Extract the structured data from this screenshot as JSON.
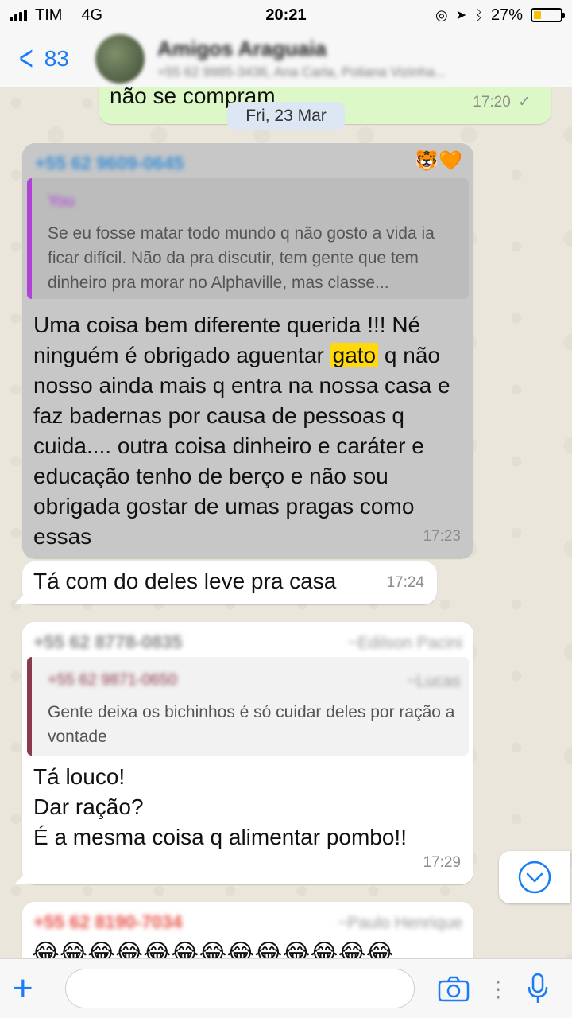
{
  "status_bar": {
    "carrier": "TIM",
    "network": "4G",
    "time": "20:21",
    "battery_percent": "27%",
    "battery_level": 0.27
  },
  "header": {
    "back_count": "83",
    "title": "Amigos Araguaia",
    "subtitle": "+55 62 9985-3436, Ana Carla, Poliana Vizinha..."
  },
  "chat": {
    "date_label": "Fri, 23 Mar",
    "messages": [
      {
        "text": "não se compram",
        "time": "17:20",
        "status_icon": "checkmark-icon"
      },
      {
        "sender": "+55 62 9609-0645",
        "reactions": "🐯🧡",
        "quote_author": "You",
        "quote_text": "Se eu fosse matar todo mundo q não gosto a vida ia ficar difícil. Não da pra discutir, tem gente que tem dinheiro pra morar no Alphaville, mas classe...",
        "text_before": "Uma coisa bem diferente querida !!! Né ninguém é obrigado aguentar ",
        "highlight": "gato",
        "text_after": " q não nosso ainda mais q entra na nossa casa e faz badernas por causa de pessoas q cuida.... outra coisa dinheiro e caráter e educação tenho de berço e não sou obrigada gostar de umas pragas como essas",
        "time": "17:23"
      },
      {
        "text": "Tá com do deles leve pra casa",
        "time": "17:24"
      },
      {
        "sender": "+55 62 8778-0835",
        "sender_name": "~Edilson Pacini",
        "quote_author": "+55 62 9871-0650",
        "quote_author_name": "~Lucas",
        "quote_text": "Gente deixa os bichinhos é só cuidar deles por ração a vontade",
        "lines": [
          "Tá louco!",
          "Dar ração?",
          "É a mesma coisa q alimentar pombo!!"
        ],
        "time": "17:29"
      },
      {
        "sender": "+55 62 8190-7034",
        "sender_name": "~Paulo Henrique",
        "emojis": "😂😂😂😂😂😂😂😂😂😂😂😂😂"
      }
    ]
  },
  "input": {
    "placeholder": ""
  },
  "colors": {
    "accent": "#1a7cf6",
    "outgoing": "#dcf8c6",
    "incoming": "#ffffff",
    "highlight": "#ffd90a"
  }
}
